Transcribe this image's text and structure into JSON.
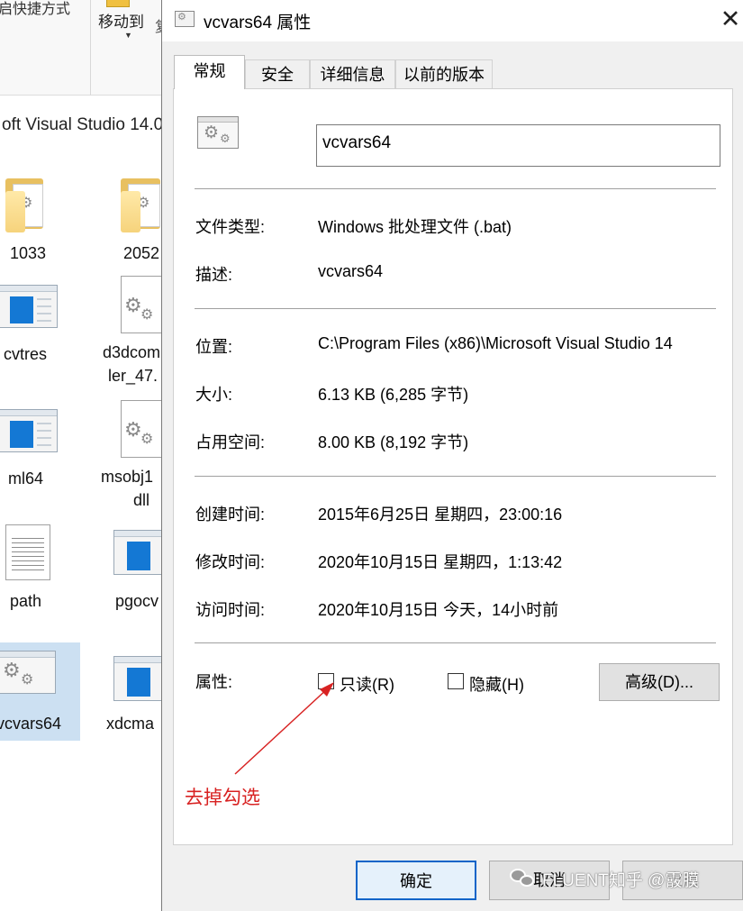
{
  "explorer": {
    "ribbon_cut_text": "启快捷方式",
    "ribbon_move_label": "移动到",
    "path_text": "oft Visual Studio 14.0",
    "items": [
      {
        "label": "1033",
        "icon": "folder-icon"
      },
      {
        "label": "2052",
        "icon": "folder-icon"
      },
      {
        "label": "cvtres",
        "icon": "exe-icon"
      },
      {
        "label": "d3dcom",
        "label2": "ler_47.",
        "icon": "dll-icon"
      },
      {
        "label": "ml64",
        "icon": "exe-icon"
      },
      {
        "label": "msobj1",
        "label2": "dll",
        "icon": "dll-icon"
      },
      {
        "label": "path",
        "icon": "text-file-icon"
      },
      {
        "label": "pgocv",
        "icon": "exe-icon"
      },
      {
        "label": "vcvars64",
        "icon": "batch-file-icon",
        "selected": true
      },
      {
        "label": "xdcma",
        "icon": "exe-icon"
      }
    ]
  },
  "dialog": {
    "title": "vcvars64 属性",
    "tabs": [
      {
        "label": "常规",
        "active": true
      },
      {
        "label": "安全",
        "active": false
      },
      {
        "label": "详细信息",
        "active": false
      },
      {
        "label": "以前的版本",
        "active": false
      }
    ],
    "file_name": "vcvars64",
    "fields": {
      "type_label": "文件类型:",
      "type_value": "Windows 批处理文件 (.bat)",
      "desc_label": "描述:",
      "desc_value": "vcvars64",
      "location_label": "位置:",
      "location_value": "C:\\Program Files (x86)\\Microsoft Visual Studio 14",
      "size_label": "大小:",
      "size_value": "6.13 KB (6,285 字节)",
      "disk_label": "占用空间:",
      "disk_value": "8.00 KB (8,192 字节)",
      "created_label": "创建时间:",
      "created_value": "2015年6月25日 星期四，23:00:16",
      "modified_label": "修改时间:",
      "modified_value": "2020年10月15日 星期四，1:13:42",
      "accessed_label": "访问时间:",
      "accessed_value": "2020年10月15日 今天，14小时前"
    },
    "attributes": {
      "label": "属性:",
      "readonly_label": "只读(R)",
      "readonly_checked": false,
      "hidden_label": "隐藏(H)",
      "hidden_checked": false,
      "advanced_label": "高级(D)..."
    },
    "annotation": {
      "text": "去掉勾选",
      "color": "#d82222"
    },
    "buttons": {
      "ok": "确定",
      "cancel": "取消",
      "apply": "应用"
    }
  },
  "watermark": {
    "text": "FLUENT知乎 @霰膜"
  },
  "colors": {
    "ok_border": "#0a64c8",
    "selection": "#cce0f2",
    "annotation": "#d82222"
  }
}
